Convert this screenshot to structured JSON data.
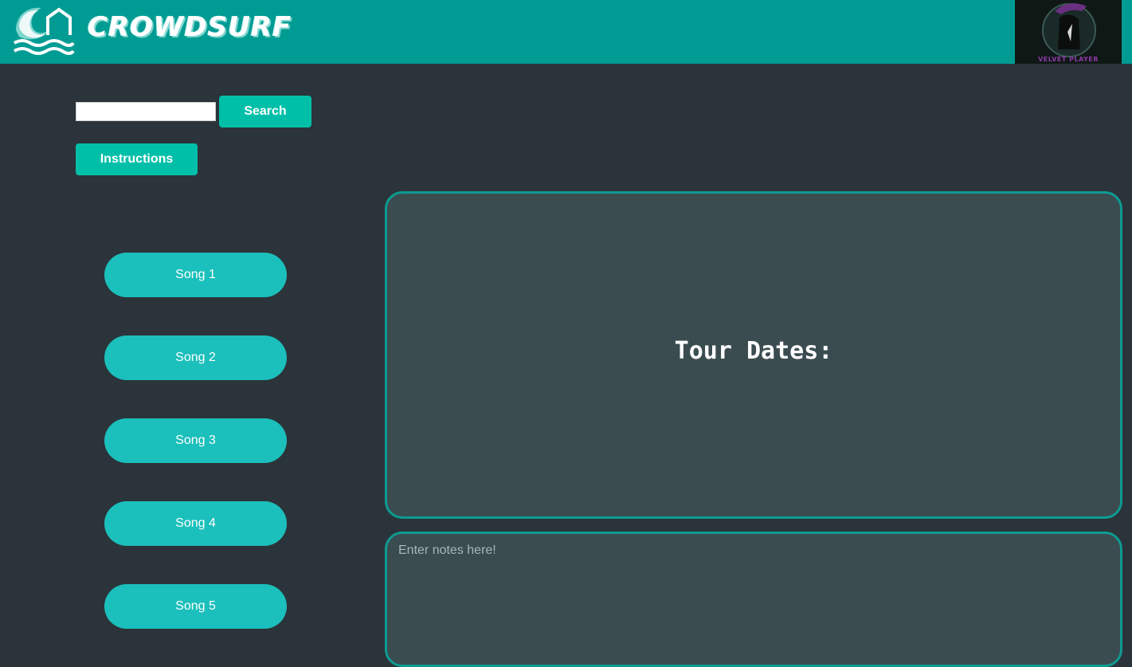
{
  "header": {
    "brand": "CROWDSURF",
    "logo_icon": "wave-house-icon",
    "artist_thumbnail_caption": "VELVET PLAYER"
  },
  "search": {
    "value": "",
    "placeholder": "",
    "button_label": "Search"
  },
  "instructions": {
    "button_label": "Instructions"
  },
  "songs": [
    {
      "label": "Song 1"
    },
    {
      "label": "Song 2"
    },
    {
      "label": "Song 3"
    },
    {
      "label": "Song 4"
    },
    {
      "label": "Song 5"
    }
  ],
  "tour": {
    "title": "Tour Dates:"
  },
  "notes": {
    "value": "",
    "placeholder": "Enter notes here!"
  },
  "colors": {
    "header": "#009c93",
    "background": "#2b343a",
    "accent_button": "#00bfa9",
    "song_button": "#1bbfbb",
    "panel": "#3b4c51",
    "panel_border": "#0d9b92"
  }
}
